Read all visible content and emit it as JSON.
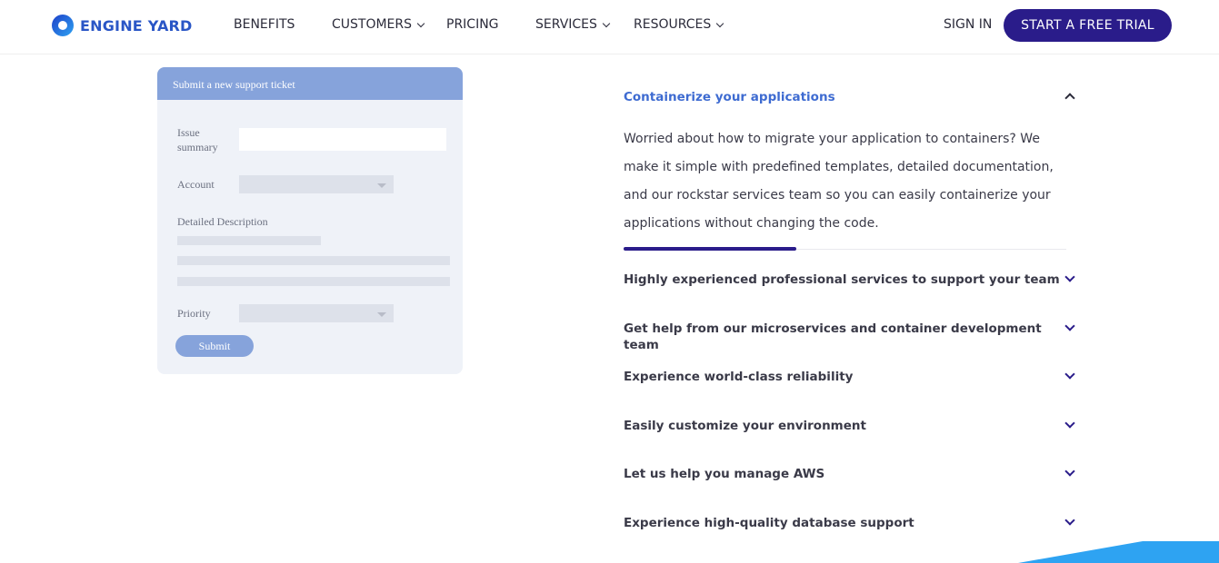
{
  "header": {
    "logo_text": "ENGINE YARD",
    "nav": [
      {
        "label": "BENEFITS",
        "has_dropdown": false
      },
      {
        "label": "CUSTOMERS",
        "has_dropdown": true
      },
      {
        "label": "PRICING",
        "has_dropdown": false
      },
      {
        "label": "SERVICES",
        "has_dropdown": true
      },
      {
        "label": "RESOURCES",
        "has_dropdown": true
      }
    ],
    "sign_in": "SIGN IN",
    "cta": "START A FREE TRIAL"
  },
  "ticket_form": {
    "title": "Submit a new support ticket",
    "issue_summary_label": "Issue summary",
    "account_label": "Account",
    "description_label": "Detailed Description",
    "priority_label": "Priority",
    "submit_label": "Submit"
  },
  "accordion": {
    "open": {
      "title": "Containerize your applications",
      "body": "Worried about how to migrate your application to containers? We make it simple with predefined templates, detailed documentation, and our rockstar services team so you can easily containerize your applications without changing the code.",
      "progress": 0.39
    },
    "items": [
      "Highly experienced professional services to support your team",
      "Get help from our microservices and container development team",
      "Experience world-class reliability",
      "Easily customize your environment",
      "Let us help you manage AWS",
      "Experience high-quality database support"
    ]
  },
  "colors": {
    "brand_blue": "#2a56c6",
    "cta_purple": "#2a1c8a",
    "accent_blue": "#3e6bd1",
    "form_header": "#86a3db",
    "corner_blue": "#2ea3f2"
  }
}
